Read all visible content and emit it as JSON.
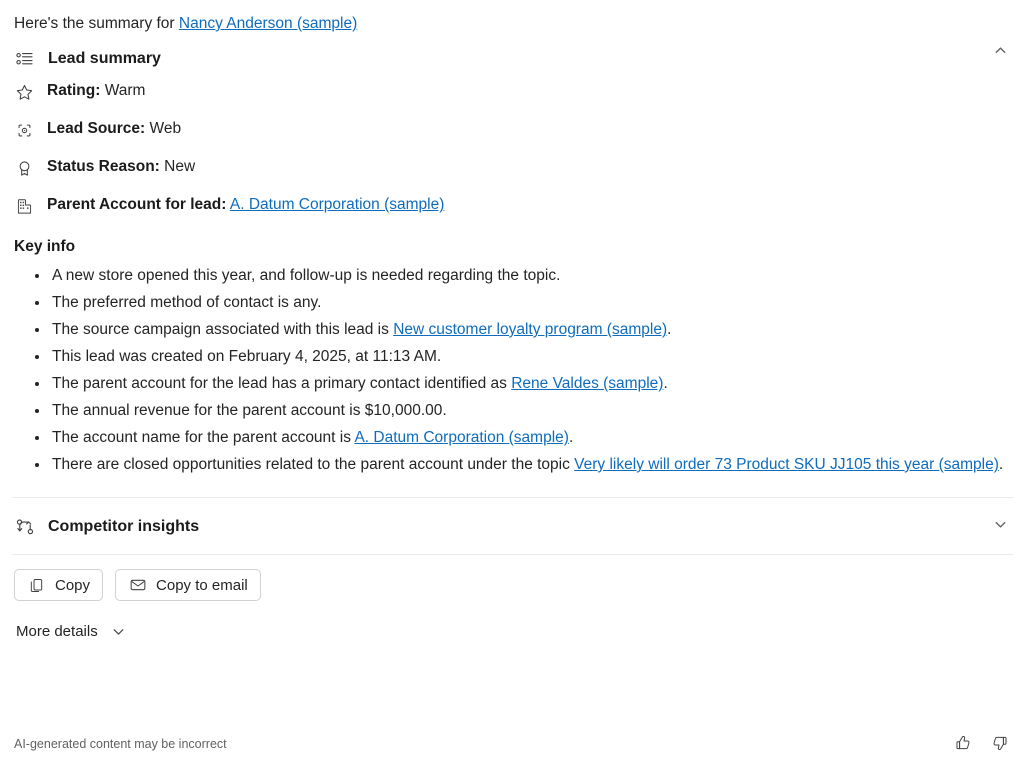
{
  "intro": {
    "prefix": "Here's the summary for ",
    "link": "Nancy Anderson (sample)"
  },
  "lead_summary": {
    "title": "Lead summary",
    "icon": "bulleted-list-icon",
    "collapse_state": "expanded",
    "chevron": "chevron-up-icon",
    "fields": [
      {
        "icon": "star-icon",
        "label": "Rating:",
        "value": "Warm"
      },
      {
        "icon": "lead-source-icon",
        "label": "Lead Source:",
        "value": "Web"
      },
      {
        "icon": "award-icon",
        "label": "Status Reason:",
        "value": "New"
      },
      {
        "icon": "building-icon",
        "label": "Parent Account for lead:",
        "value": "A. Datum Corporation (sample)",
        "value_is_link": true
      }
    ],
    "key_info_title": "Key info",
    "key_info": [
      {
        "parts": [
          {
            "t": "A new store opened this year, and follow-up is needed regarding the topic."
          }
        ]
      },
      {
        "parts": [
          {
            "t": "The preferred method of contact is any."
          }
        ]
      },
      {
        "parts": [
          {
            "t": "The source campaign associated with this lead is "
          },
          {
            "t": "New customer loyalty program (sample)",
            "link": true
          },
          {
            "t": "."
          }
        ]
      },
      {
        "parts": [
          {
            "t": "This lead was created on February 4, 2025, at 11:13 AM."
          }
        ]
      },
      {
        "parts": [
          {
            "t": "The parent account for the lead has a primary contact identified as "
          },
          {
            "t": "Rene Valdes (sample)",
            "link": true
          },
          {
            "t": "."
          }
        ]
      },
      {
        "parts": [
          {
            "t": "The annual revenue for the parent account is $10,000.00."
          }
        ]
      },
      {
        "parts": [
          {
            "t": "The account name for the parent account is "
          },
          {
            "t": "A. Datum Corporation (sample)",
            "link": true
          },
          {
            "t": "."
          }
        ]
      },
      {
        "parts": [
          {
            "t": "There are closed opportunities related to the parent account under the topic "
          },
          {
            "t": "Very likely will order 73 Product SKU JJ105 this year (sample)",
            "link": true
          },
          {
            "t": "."
          }
        ]
      }
    ]
  },
  "competitor_insights": {
    "title": "Competitor insights",
    "icon": "branch-compare-icon",
    "collapse_state": "collapsed",
    "chevron": "chevron-down-icon"
  },
  "actions": {
    "copy_label": "Copy",
    "copy_icon": "copy-icon",
    "copy_to_email_label": "Copy to email",
    "copy_to_email_icon": "mail-icon"
  },
  "more_details": {
    "label": "More details",
    "chevron": "chevron-down-icon"
  },
  "footer": {
    "disclaimer": "AI-generated content may be incorrect",
    "thumbs_up_icon": "thumbs-up-icon",
    "thumbs_down_icon": "thumbs-down-icon"
  },
  "colors": {
    "link": "#0f6cbd",
    "text": "#242424",
    "muted": "#616161",
    "divider": "#ebebeb",
    "button_border": "#d1d1d1"
  }
}
